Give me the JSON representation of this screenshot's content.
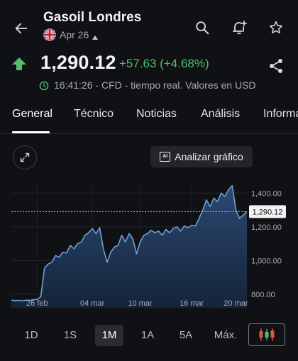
{
  "header": {
    "title": "Gasoil Londres",
    "date": "Apr 26"
  },
  "quote": {
    "price": "1,290.12",
    "change": "+57.63 (+4.68%)",
    "meta": "16:41:26 - CFD - tiempo real. Valores en USD"
  },
  "tabs": [
    "General",
    "Técnico",
    "Noticias",
    "Análisis",
    "Informa"
  ],
  "analyze_label": "Analizar gráfico",
  "ranges": [
    "1D",
    "1S",
    "1M",
    "1A",
    "5A",
    "Máx."
  ],
  "colors": {
    "accent_up": "#4fbf6d",
    "line": "#6e9fd6"
  },
  "icons": [
    "arrow-left-icon",
    "uk-flag-icon",
    "search-icon",
    "add-alert-icon",
    "star-icon",
    "arrow-up-icon",
    "share-icon",
    "clock-icon",
    "expand-icon",
    "ai-icon",
    "candlestick-icon"
  ],
  "chart_data": {
    "type": "area",
    "x_ticks": [
      "26 feb",
      "04 mar",
      "10 mar",
      "16 mar",
      "20 mar"
    ],
    "y_ticks": [
      800,
      1000,
      1200,
      1400
    ],
    "y_tick_labels": [
      "800.00",
      "1,000.00",
      "1,200.00",
      "1,400.00"
    ],
    "ylim": [
      720,
      1460
    ],
    "current_value_label": "1,290.12",
    "current_value": 1290.12,
    "grid": true,
    "values": [
      765,
      763,
      764,
      762,
      765,
      764,
      768,
      770,
      785,
      955,
      980,
      990,
      1030,
      1020,
      1050,
      1045,
      1090,
      1070,
      1100,
      1110,
      1150,
      1165,
      1190,
      1160,
      1195,
      1070,
      990,
      1050,
      1080,
      1090,
      1150,
      1110,
      1160,
      1130,
      1040,
      1110,
      1150,
      1160,
      1180,
      1165,
      1175,
      1150,
      1185,
      1165,
      1190,
      1200,
      1175,
      1205,
      1195,
      1210,
      1205,
      1250,
      1300,
      1360,
      1320,
      1370,
      1350,
      1400,
      1380,
      1420,
      1445,
      1300,
      1250,
      1270,
      1290
    ]
  }
}
